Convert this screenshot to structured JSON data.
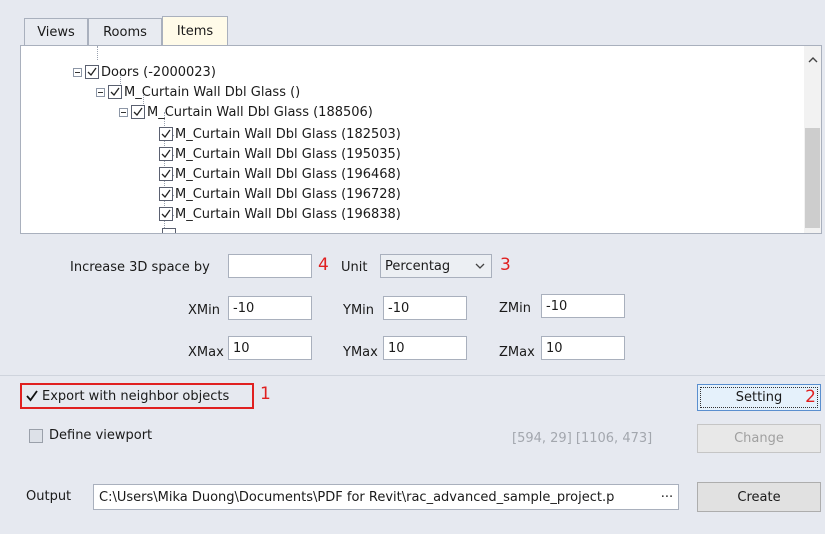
{
  "tabs": [
    "Views",
    "Rooms",
    "Items"
  ],
  "tree": [
    "Doors (-2000023)",
    "M_Curtain Wall Dbl Glass ()",
    "M_Curtain Wall Dbl Glass (188506)",
    "M_Curtain Wall Dbl Glass (182503)",
    "M_Curtain Wall Dbl Glass (195035)",
    "M_Curtain Wall Dbl Glass (196468)",
    "M_Curtain Wall Dbl Glass (196728)",
    "M_Curtain Wall Dbl Glass (196838)"
  ],
  "space": {
    "label": "Increase 3D space by",
    "value": "",
    "annotation_a": "4",
    "unit_label": "Unit",
    "unit_value": "Percentag",
    "annotation_b": "3"
  },
  "bounds": {
    "xmin_label": "XMin",
    "xmin": "-10",
    "ymin_label": "YMin",
    "ymin": "-10",
    "zmin_label": "ZMin",
    "zmin": "-10",
    "xmax_label": "XMax",
    "xmax": "10",
    "ymax_label": "YMax",
    "ymax": "10",
    "zmax_label": "ZMax",
    "zmax": "10"
  },
  "export": {
    "label": "Export with neighbor objects",
    "checked": true,
    "annotation": "1"
  },
  "setting": {
    "label": "Setting",
    "annotation": "2"
  },
  "viewport": {
    "label": "Define viewport",
    "coords": "[594, 29] [1106, 473]",
    "change_label": "Change"
  },
  "output": {
    "label": "Output",
    "path": "C:\\Users\\Mika Duong\\Documents\\PDF for Revit\\rac_advanced_sample_project.p",
    "browse": "···"
  },
  "create_label": "Create",
  "colors": {
    "annotation": "#e02020",
    "active_tab": "#fffbe9",
    "panel_bg": "#e6e9f0"
  }
}
